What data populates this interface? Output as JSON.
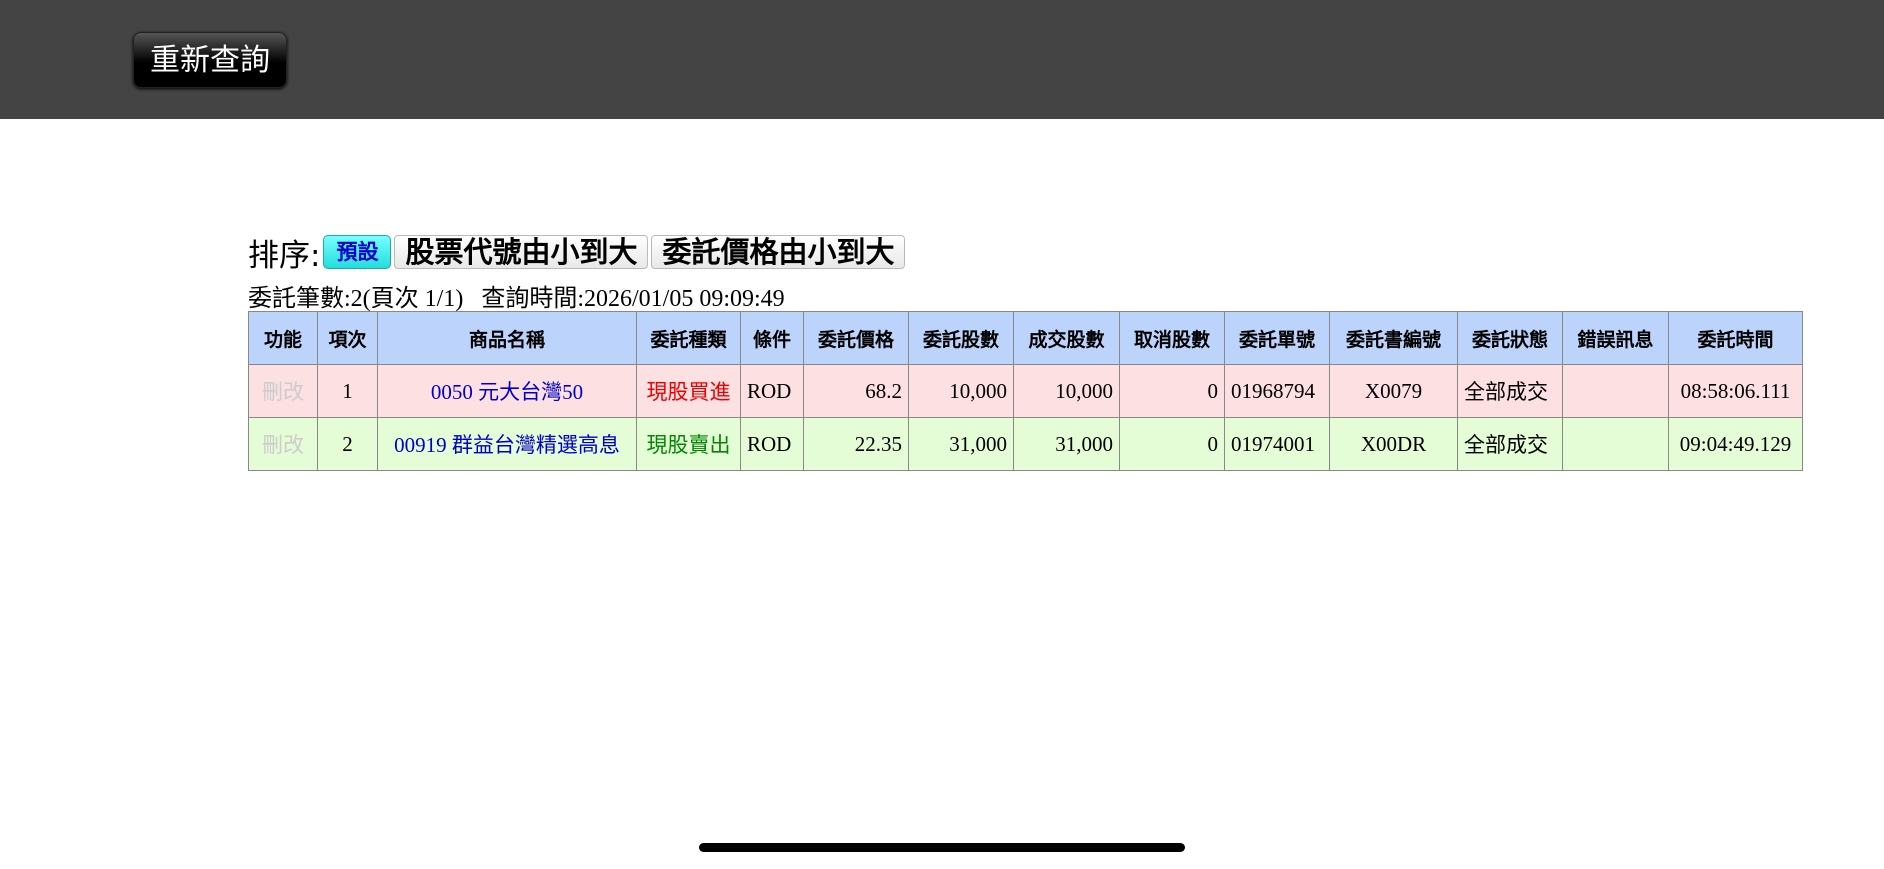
{
  "toolbar": {
    "requery_label": "重新查詢"
  },
  "sort": {
    "label": "排序:",
    "options": [
      {
        "label": "預設",
        "active": true
      },
      {
        "label": "股票代號由小到大",
        "active": false
      },
      {
        "label": "委託價格由小到大",
        "active": false
      }
    ]
  },
  "info": {
    "count_text": "委託筆數:2(頁次 1/1)",
    "query_time_text": "查詢時間:2026/01/05 09:09:49"
  },
  "table": {
    "headers": [
      "功能",
      "項次",
      "商品名稱",
      "委託種類",
      "條件",
      "委託價格",
      "委託股數",
      "成交股數",
      "取消股數",
      "委託單號",
      "委託書編號",
      "委託狀態",
      "錯誤訊息",
      "委託時間"
    ],
    "rows": [
      {
        "action": "刪改",
        "index": "1",
        "product": "0050 元大台灣50",
        "order_type": "現股買進",
        "condition": "ROD",
        "price": "68.2",
        "order_qty": "10,000",
        "filled_qty": "10,000",
        "cancel_qty": "0",
        "order_no": "01968794",
        "book_no": "X0079",
        "status": "全部成交",
        "error": "",
        "time": "08:58:06.111"
      },
      {
        "action": "刪改",
        "index": "2",
        "product": "00919 群益台灣精選高息",
        "order_type": "現股賣出",
        "condition": "ROD",
        "price": "22.35",
        "order_qty": "31,000",
        "filled_qty": "31,000",
        "cancel_qty": "0",
        "order_no": "01974001",
        "book_no": "X00DR",
        "status": "全部成交",
        "error": "",
        "time": "09:04:49.129"
      }
    ]
  },
  "colors": {
    "header_bg": "#bcd3fb",
    "buy_row_bg": "#fde0e2",
    "sell_row_bg": "#e4fdd6",
    "buy_text": "#e00000",
    "sell_text": "#008800",
    "product_text": "#0000cc",
    "topbar_bg": "#444444"
  }
}
